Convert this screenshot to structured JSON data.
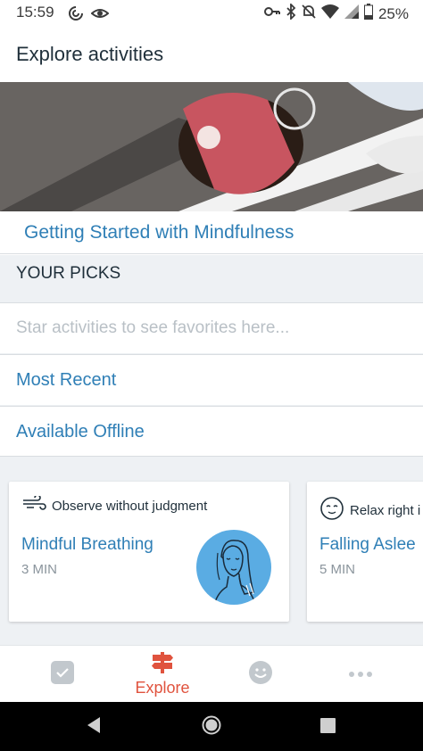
{
  "status_bar": {
    "time": "15:59",
    "battery": "25%",
    "left_icons": [
      "sync-icon",
      "eye-icon"
    ],
    "right_icons": [
      "key-icon",
      "bluetooth-icon",
      "mute-icon",
      "wifi-icon",
      "signal-icon",
      "battery-icon"
    ]
  },
  "header": {
    "title": "Explore activities"
  },
  "featured": {
    "title": "Getting Started with Mindfulness"
  },
  "picks": {
    "header": "YOUR PICKS",
    "placeholder": "Star activities to see favorites here...",
    "most_recent": "Most Recent",
    "available_offline": "Available Offline"
  },
  "cards": [
    {
      "tag": "Observe without judgment",
      "tag_icon": "wind-icon",
      "title": "Mindful Breathing",
      "duration": "3 MIN"
    },
    {
      "tag": "Relax right i",
      "tag_icon": "calm-face-icon",
      "title": "Falling Aslee",
      "duration": "5 MIN"
    }
  ],
  "nav": {
    "explore_label": "Explore",
    "active_color": "#e0533e",
    "inactive_color": "#c2c8cd"
  },
  "colors": {
    "accent": "#2f7fb6",
    "brand": "#e0533e",
    "section_bg": "#eef1f4"
  }
}
